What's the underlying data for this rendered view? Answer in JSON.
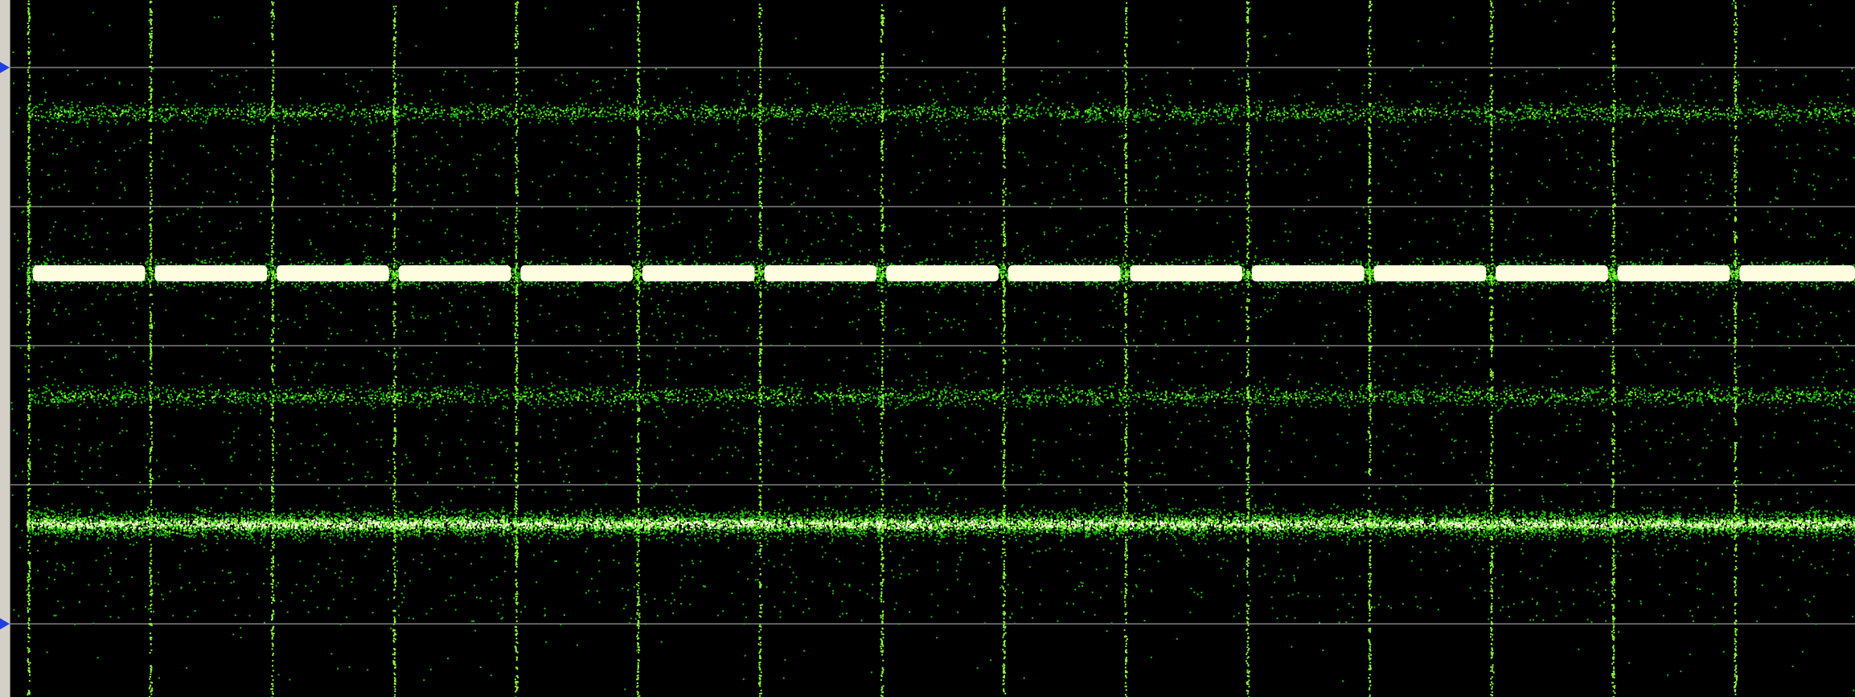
{
  "colors": {
    "background": "#000000",
    "trace_dim": "#1fbf0a",
    "trace_bright": "#8cff3a",
    "trace_core": "#fffde0",
    "graticule": "#bfbfbf",
    "marker": "#1f3fe0",
    "rail": "#d4d0c8"
  },
  "display": {
    "graticule_divisions": 4,
    "markers": [
      "upper-level-marker",
      "lower-level-marker"
    ],
    "segment_count": 15,
    "bands": [
      {
        "name": "band-1",
        "level": 0.08,
        "density": "sparse"
      },
      {
        "name": "band-2",
        "level": 0.37,
        "density": "saturated"
      },
      {
        "name": "band-3",
        "level": 0.59,
        "density": "sparse"
      },
      {
        "name": "band-4",
        "level": 0.82,
        "density": "dense"
      }
    ]
  }
}
